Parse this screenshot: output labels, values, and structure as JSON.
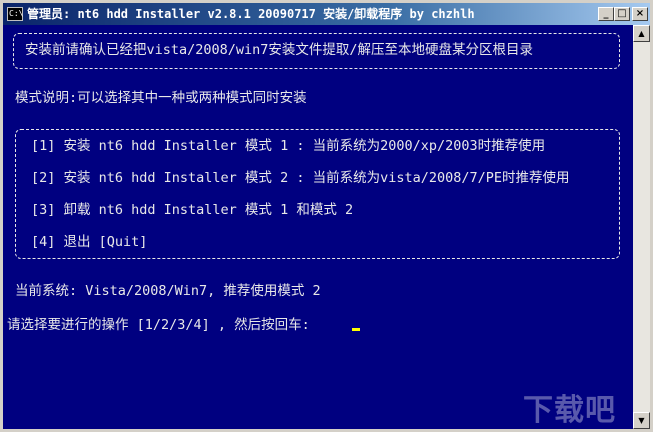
{
  "window": {
    "icon_text": "C:\\",
    "title": "管理员:  nt6 hdd Installer v2.8.1 20090717 安装/卸载程序 by chzhlh",
    "minimize_glyph": "_",
    "maximize_glyph": "□",
    "close_glyph": "×"
  },
  "console": {
    "notice": "安装前请确认已经把vista/2008/win7安装文件提取/解压至本地硬盘某分区根目录",
    "mode_description": "模式说明:可以选择其中一种或两种模式同时安装",
    "options": [
      "[1] 安装 nt6 hdd Installer 模式 1 : 当前系统为2000/xp/2003时推荐使用",
      "[2] 安装 nt6 hdd Installer 模式 2 : 当前系统为vista/2008/7/PE时推荐使用",
      "[3] 卸载 nt6 hdd Installer 模式 1 和模式 2",
      "[4] 退出 [Quit]"
    ],
    "current_system": "当前系统: Vista/2008/Win7, 推荐使用模式 2",
    "prompt": "请选择要进行的操作 [1/2/3/4] , 然后按回车:"
  },
  "scrollbar": {
    "up_glyph": "▲",
    "down_glyph": "▼"
  },
  "watermark": "下载吧",
  "colors": {
    "console_bg": "#000080",
    "console_text": "#e8e8e8",
    "cursor": "#ffff00",
    "title_bar": "#0a246a"
  }
}
